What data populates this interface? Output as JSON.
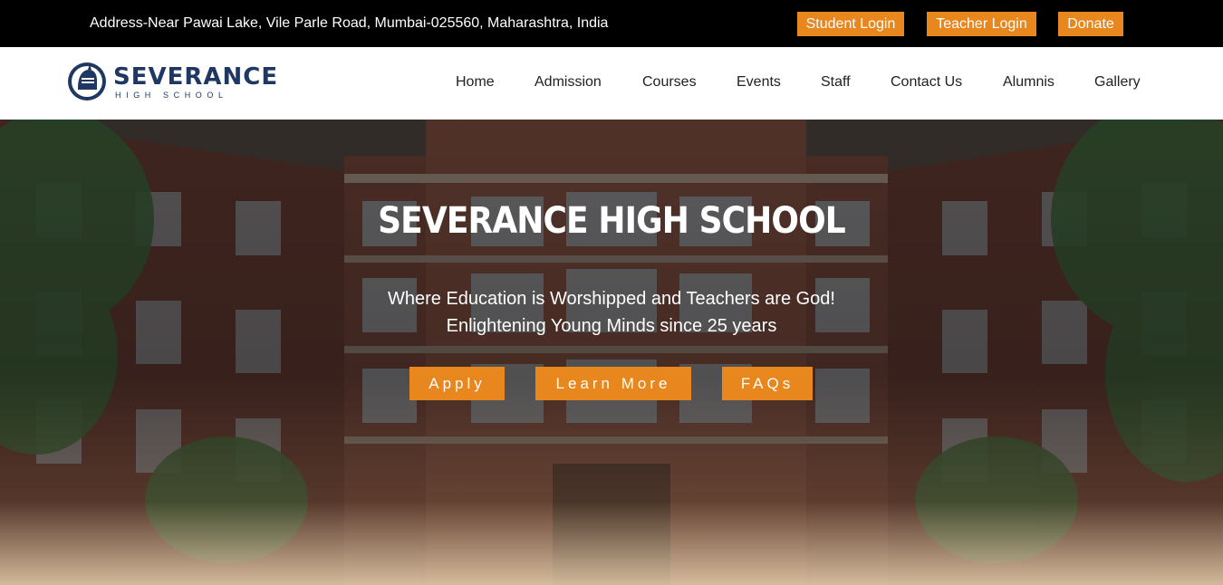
{
  "topbar": {
    "address": "Address-Near Pawai Lake, Vile Parle Road, Mumbai-025560, Maharashtra, India",
    "student_login": "Student Login",
    "teacher_login": "Teacher Login",
    "donate": "Donate"
  },
  "logo": {
    "name": "SEVERANCE",
    "subtitle": "HIGH SCHOOL",
    "icon": "knight-helmet-icon"
  },
  "nav": {
    "items": [
      "Home",
      "Admission",
      "Courses",
      "Events",
      "Staff",
      "Contact Us",
      "Alumnis",
      "Gallery"
    ]
  },
  "hero": {
    "title": "SEVERANCE HIGH SCHOOL",
    "tagline_1": "Where Education is Worshipped and Teachers are God!",
    "tagline_2": "Enlightening Young Minds since 25 years",
    "buttons": {
      "apply": "Apply",
      "learn_more": "Learn More",
      "faqs": "FAQs"
    }
  },
  "colors": {
    "accent": "#e8871e",
    "brand": "#1f3763",
    "topbar_bg": "#000000"
  }
}
